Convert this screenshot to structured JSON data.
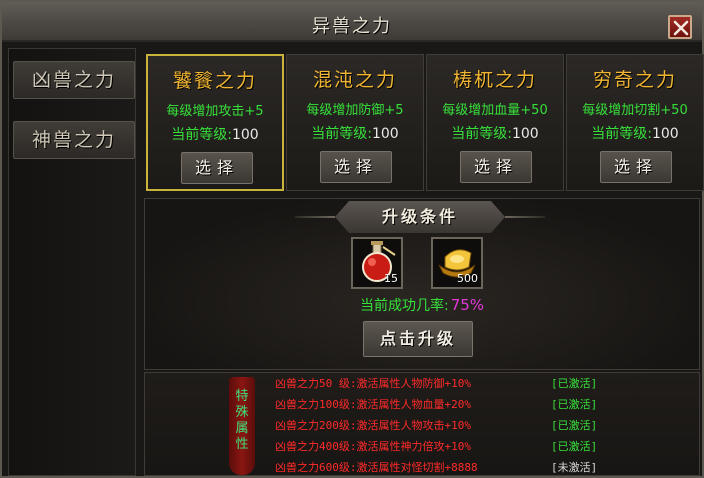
{
  "window": {
    "title": "异兽之力"
  },
  "sidebar": {
    "tabs": [
      {
        "label": "凶兽之力"
      },
      {
        "label": "神兽之力"
      }
    ]
  },
  "beasts": [
    {
      "name": "饕餮之力",
      "bonus": "每级增加攻击+5",
      "level_label": "当前等级:",
      "level": "100",
      "button": "选择",
      "selected": true
    },
    {
      "name": "混沌之力",
      "bonus": "每级增加防御+5",
      "level_label": "当前等级:",
      "level": "100",
      "button": "选择",
      "selected": false
    },
    {
      "name": "梼杌之力",
      "bonus": "每级增加血量+50",
      "level_label": "当前等级:",
      "level": "100",
      "button": "选择",
      "selected": false
    },
    {
      "name": "穷奇之力",
      "bonus": "每级增加切割+50",
      "level_label": "当前等级:",
      "level": "100",
      "button": "选择",
      "selected": false
    }
  ],
  "upgrade": {
    "header": "升级条件",
    "items": [
      {
        "icon": "red-potion-flask-icon",
        "qty": "15"
      },
      {
        "icon": "gold-ingot-icon",
        "qty": "500"
      }
    ],
    "rate_label": "当前成功几率:",
    "rate_value": "75%",
    "button": "点击升级"
  },
  "attributes": {
    "badge": [
      "特",
      "殊",
      "属",
      "性"
    ],
    "rows": [
      {
        "desc": "凶兽之力50 级:激活属性人物防御+10%",
        "status": "[已激活]",
        "active": true
      },
      {
        "desc": "凶兽之力100级:激活属性人物血量+20%",
        "status": "[已激活]",
        "active": true
      },
      {
        "desc": "凶兽之力200级:激活属性人物攻击+10%",
        "status": "[已激活]",
        "active": true
      },
      {
        "desc": "凶兽之力400级:激活属性神力倍攻+10%",
        "status": "[已激活]",
        "active": true
      },
      {
        "desc": "凶兽之力600级:激活属性对怪切割+8888",
        "status": "[未激活]",
        "active": false
      }
    ]
  },
  "colors": {
    "gold": "#f0b531",
    "green": "#36e03a",
    "red": "#ff2a2a",
    "magenta": "#e23ad6",
    "selection": "#c9b33a"
  }
}
